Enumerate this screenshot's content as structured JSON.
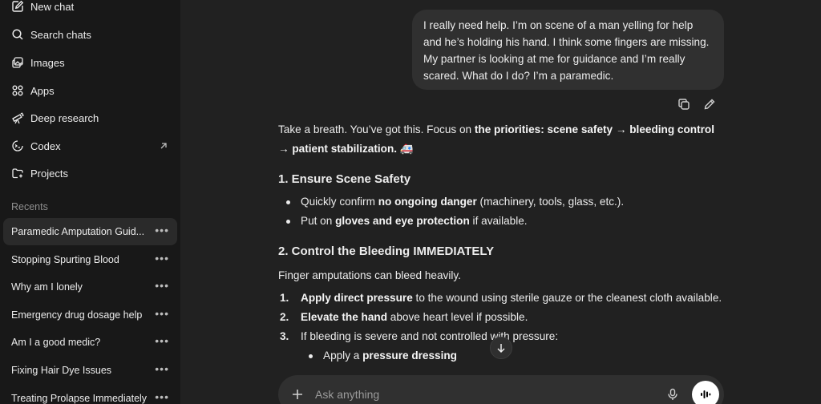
{
  "sidebar": {
    "nav": [
      {
        "label": "New chat",
        "icon": "new-chat-icon"
      },
      {
        "label": "Search chats",
        "icon": "search-icon"
      },
      {
        "label": "Images",
        "icon": "images-icon"
      },
      {
        "label": "Apps",
        "icon": "apps-icon"
      },
      {
        "label": "Deep research",
        "icon": "telescope-icon"
      },
      {
        "label": "Codex",
        "icon": "codex-icon"
      },
      {
        "label": "Projects",
        "icon": "folder-icon"
      }
    ],
    "recents_label": "Recents",
    "chats": [
      "Paramedic Amputation Guid...",
      "Stopping Spurting Blood",
      "Why am I lonely",
      "Emergency drug dosage help",
      "Am I a good medic?",
      "Fixing Hair Dye Issues",
      "Treating Prolapse Immediately"
    ]
  },
  "conversation": {
    "user_message": "I really need help. I’m on scene of a man yelling for help and he’s holding his hand. I think some fingers are missing. My partner is looking at me for guidance and I’m really scared. What do I do? I’m a paramedic.",
    "answer": {
      "intro_plain": "Take a breath. You’ve got this. Focus on ",
      "intro_bold": "the priorities: scene safety → bleeding control → patient stabilization.",
      "intro_emoji": "🚑",
      "section1_title": "1. Ensure Scene Safety",
      "s1_b1_pre": "Quickly confirm ",
      "s1_b1_bold": "no ongoing danger",
      "s1_b1_post": " (machinery, tools, glass, etc.).",
      "s1_b2_pre": "Put on ",
      "s1_b2_bold": "gloves and eye protection",
      "s1_b2_post": " if available.",
      "section2_title": "2. Control the Bleeding IMMEDIATELY",
      "s2_intro": "Finger amputations can bleed heavily.",
      "s2_items": [
        {
          "num": "1.",
          "bold": "Apply direct pressure",
          "text": " to the wound using sterile gauze or the cleanest cloth available."
        },
        {
          "num": "2.",
          "bold": "Elevate the hand",
          "text": " above heart level if possible."
        },
        {
          "num": "3.",
          "bold": "",
          "text": "If bleeding is severe and not controlled with pressure:"
        }
      ],
      "s2_sub_pre": "Apply a ",
      "s2_sub_bold": "pressure dressing"
    }
  },
  "composer": {
    "placeholder": "Ask anything"
  }
}
